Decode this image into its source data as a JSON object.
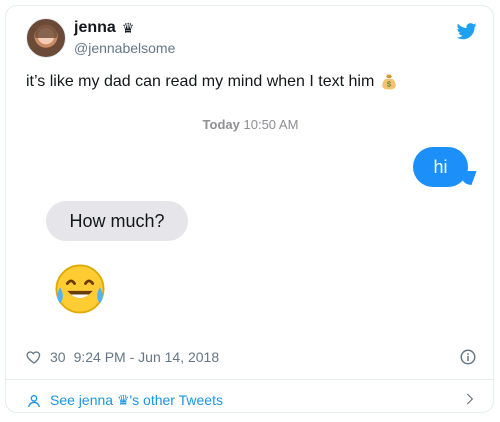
{
  "tweet": {
    "author_name": "jenna",
    "author_badge": "♛",
    "handle": "@jennabelsome",
    "text": "it’s like my dad can read my mind when I text him",
    "text_emoji": "money-bag-icon",
    "likes": "30",
    "timestamp": "9:24 PM - Jun 14, 2018",
    "see_more": "See jenna ♛'s other Tweets"
  },
  "imessage": {
    "day": "Today",
    "time": "10:50 AM",
    "sent": "hi",
    "received": "How much?",
    "emoji": "face-with-tears-of-joy"
  },
  "colors": {
    "twitter_blue": "#1da1f2",
    "link_blue": "#1b95e0",
    "imessage_blue": "#1c8ff9",
    "imessage_gray": "#e5e5ea"
  }
}
